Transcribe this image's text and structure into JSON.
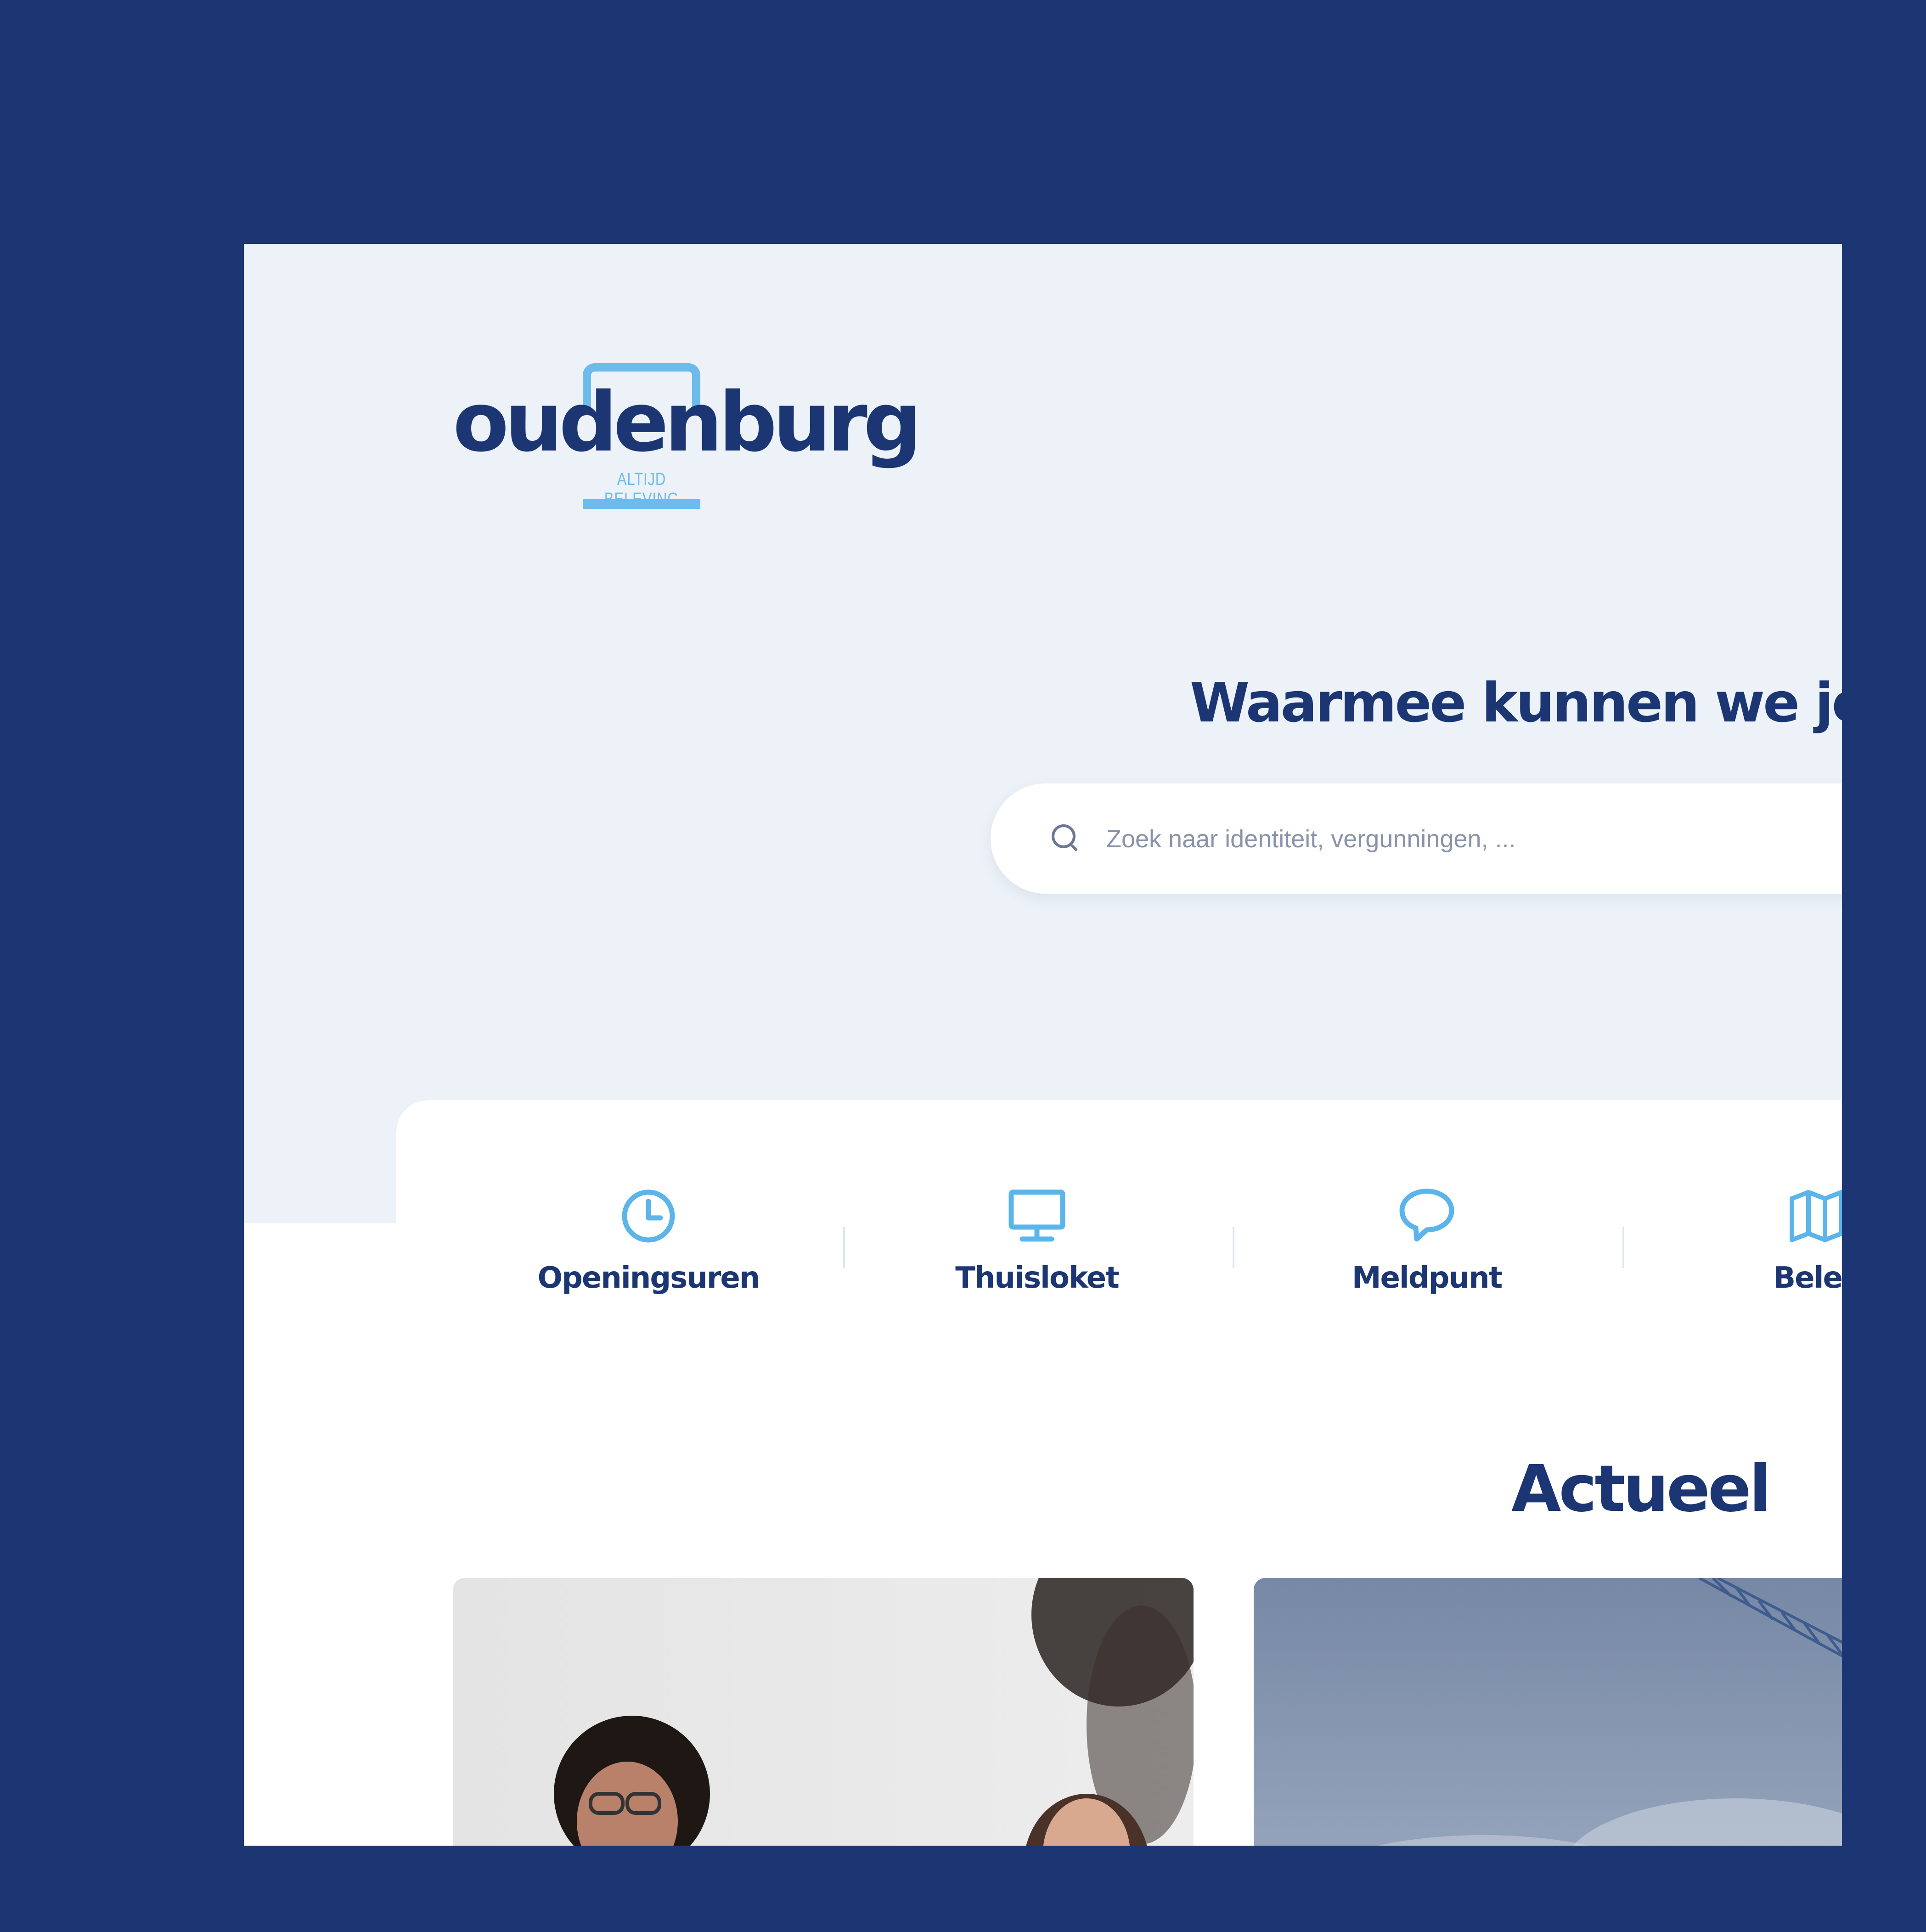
{
  "logo": {
    "name": "oudenburg",
    "tagline": "ALTIJD BELEVING"
  },
  "hero": {
    "title": "Waarmee kunnen we je"
  },
  "search": {
    "placeholder": "Zoek naar identiteit, vergunningen, ..."
  },
  "quick_links": [
    {
      "label": "Openingsuren",
      "icon": "clock-icon"
    },
    {
      "label": "Thuisloket",
      "icon": "monitor-icon"
    },
    {
      "label": "Meldpunt",
      "icon": "speech-bubble-icon"
    },
    {
      "label": "Belev",
      "icon": "map-icon"
    }
  ],
  "news": {
    "title": "Actueel",
    "cards": [
      {
        "image": "two women smiling"
      },
      {
        "image": "construction crane against cloudy sky"
      }
    ]
  },
  "colors": {
    "background": "#1b3673",
    "primary": "#1b3673",
    "accent": "#6dbbec",
    "hero_bg": "#ecf2f7"
  }
}
